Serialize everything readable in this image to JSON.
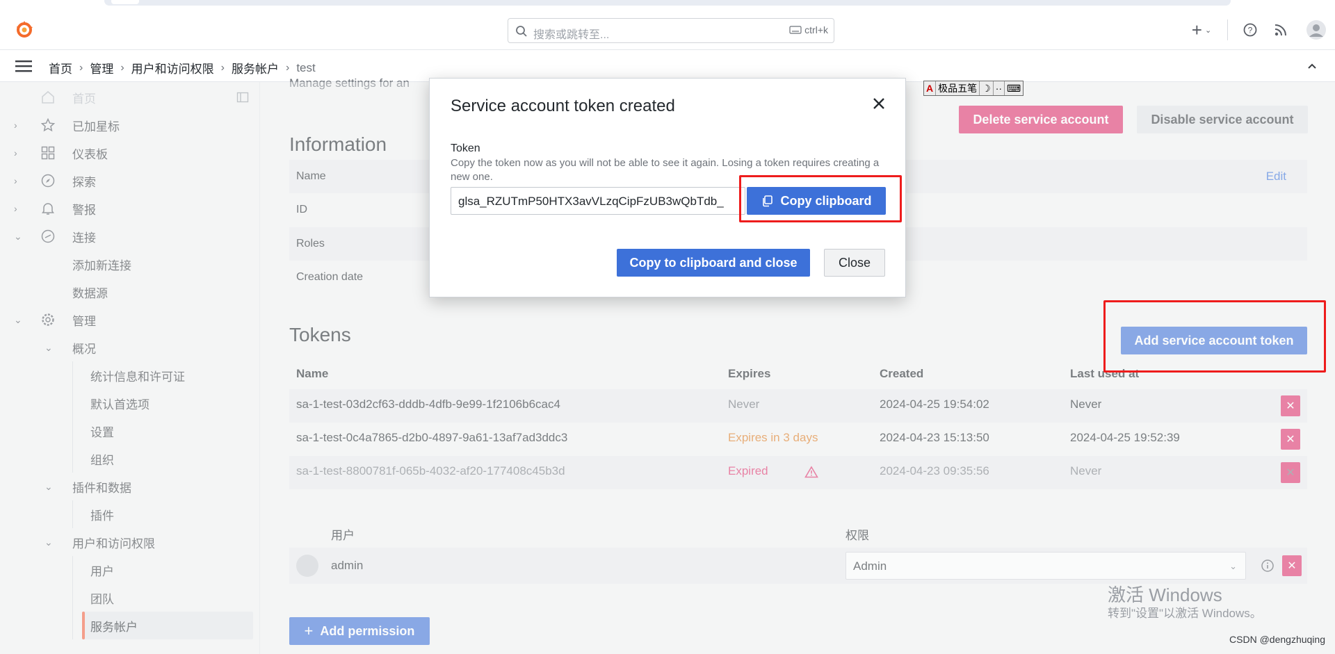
{
  "topbar": {
    "search_placeholder": "搜索或跳转至...",
    "search_shortcut": "ctrl+k",
    "plus_label": "+"
  },
  "breadcrumb": [
    "首页",
    "管理",
    "用户和访问权限",
    "服务帐户",
    "test"
  ],
  "sidebar": {
    "items": [
      {
        "label": "首页"
      },
      {
        "label": "已加星标"
      },
      {
        "label": "仪表板"
      },
      {
        "label": "探索"
      },
      {
        "label": "警报"
      },
      {
        "label": "连接"
      },
      {
        "label": "添加新连接"
      },
      {
        "label": "数据源"
      },
      {
        "label": "管理"
      },
      {
        "label": "概况"
      },
      {
        "label": "统计信息和许可证"
      },
      {
        "label": "默认首选项"
      },
      {
        "label": "设置"
      },
      {
        "label": "组织"
      },
      {
        "label": "插件和数据"
      },
      {
        "label": "插件"
      },
      {
        "label": "用户和访问权限"
      },
      {
        "label": "用户"
      },
      {
        "label": "团队"
      },
      {
        "label": "服务帐户"
      }
    ]
  },
  "page": {
    "description_cut": "Manage settings for an",
    "delete_btn": "Delete service account",
    "disable_btn": "Disable service account",
    "info_title": "Information",
    "info_rows": [
      {
        "label": "Name"
      },
      {
        "label": "ID"
      },
      {
        "label": "Roles"
      },
      {
        "label": "Creation date"
      }
    ],
    "edit_label": "Edit",
    "tokens_title": "Tokens",
    "add_token_btn": "Add service account token",
    "tokens_table": {
      "headers": [
        "Name",
        "Expires",
        "Created",
        "Last used at"
      ],
      "rows": [
        {
          "name": "sa-1-test-03d2cf63-dddb-4dfb-9e99-1f2106b6cac4",
          "expires": "Never",
          "created": "2024-04-25 19:54:02",
          "last_used": "Never"
        },
        {
          "name": "sa-1-test-0c4a7865-d2b0-4897-9a61-13af7ad3ddc3",
          "expires": "Expires in 3 days",
          "created": "2024-04-23 15:13:50",
          "last_used": "2024-04-25 19:52:39"
        },
        {
          "name": "sa-1-test-8800781f-065b-4032-af20-177408c45b3d",
          "expires": "Expired",
          "created": "2024-04-23 09:35:56",
          "last_used": "Never"
        }
      ]
    },
    "perm_headers": [
      "用户",
      "权限"
    ],
    "perm_user": "admin",
    "perm_value": "Admin",
    "add_permission_btn": "Add permission"
  },
  "modal": {
    "title": "Service account token created",
    "token_label": "Token",
    "token_desc": "Copy the token now as you will not be able to see it again. Losing a token requires creating a new one.",
    "token_value": "glsa_RZUTmP50HTX3avVLzqCipFzUB3wQbTdb_",
    "copy_btn": "Copy clipboard",
    "copy_close_btn": "Copy to clipboard and close",
    "close_btn": "Close"
  },
  "ime": [
    "A",
    "极品五笔",
    "☽",
    "··",
    "⌨"
  ],
  "watermark": {
    "line1": "激活 Windows",
    "line2": "转到\"设置\"以激活 Windows。"
  },
  "credit": "CSDN @dengzhuqing",
  "colors": {
    "primary": "#3d71d9",
    "danger": "#e02f6b",
    "warning": "#e07a1f",
    "annotation_red": "#ee1c1c",
    "active_marker": "#f55f3e"
  }
}
